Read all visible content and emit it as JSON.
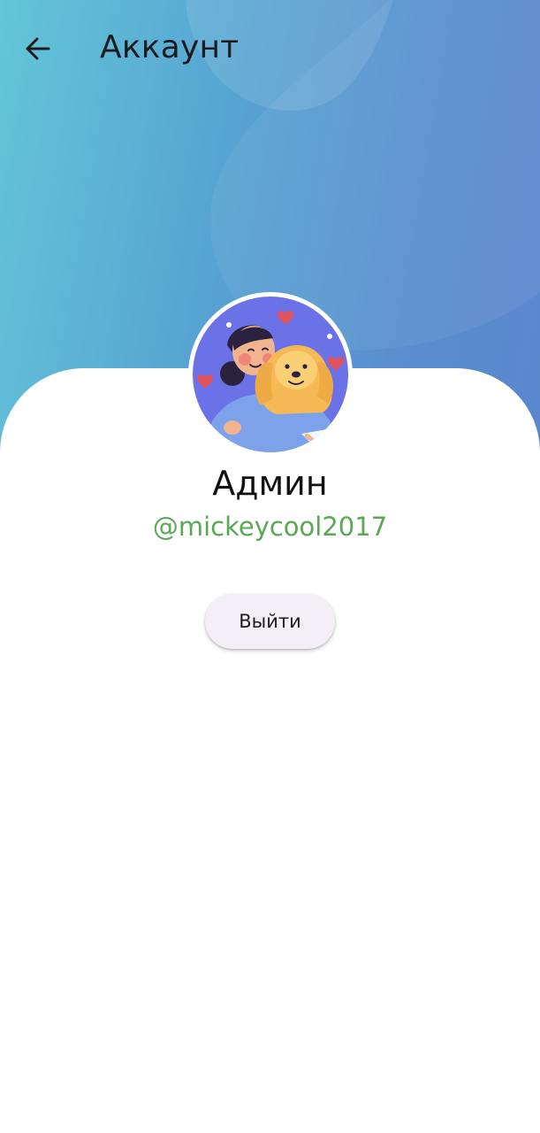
{
  "app_bar": {
    "back_icon": "arrow-left-icon",
    "title": "Аккаунт"
  },
  "profile": {
    "avatar": "avatar-illustration-woman-hugging-dog",
    "name": "Админ",
    "handle": "@mickeycool2017"
  },
  "actions": {
    "logout_label": "Выйти"
  },
  "colors": {
    "header_gradient_start": "#63c6d9",
    "header_gradient_end": "#5b86cd",
    "handle_text": "#5aa854",
    "button_background": "#f4eff7",
    "avatar_background": "#6b72e8"
  }
}
